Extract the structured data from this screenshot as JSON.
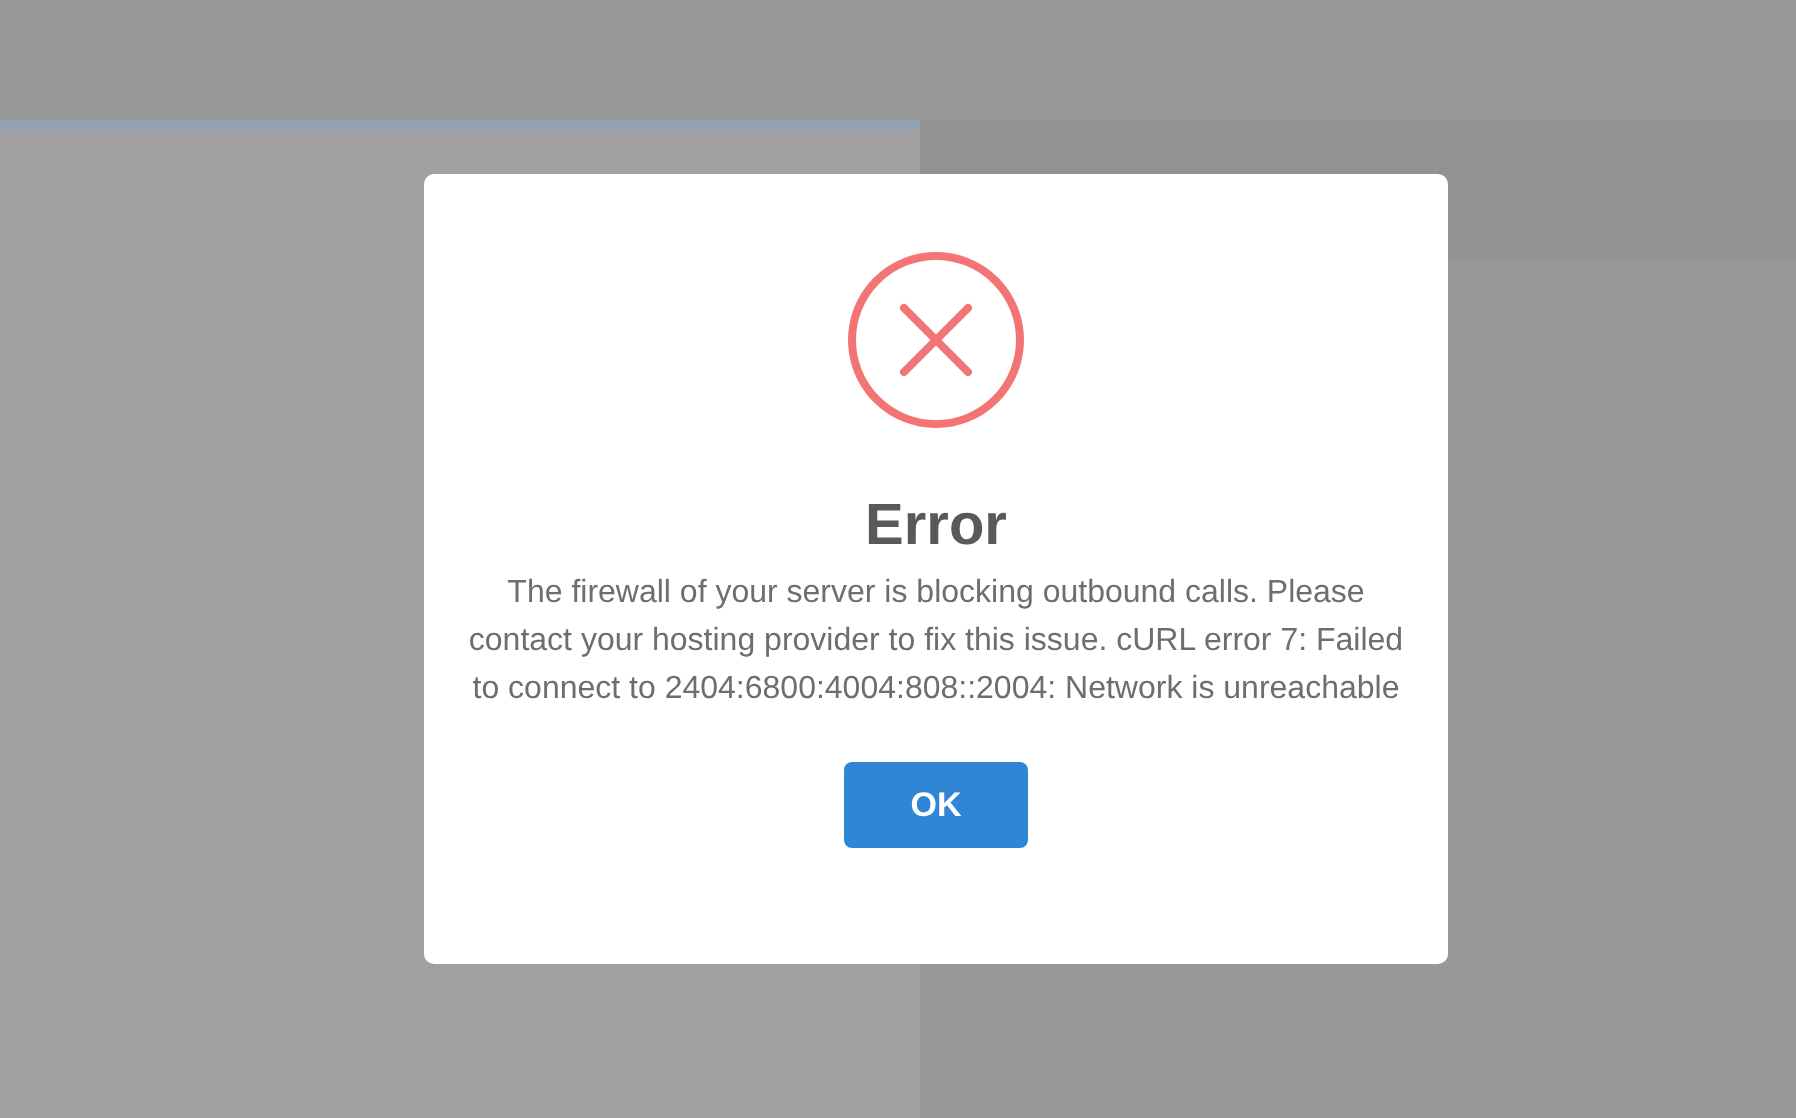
{
  "dialog": {
    "title": "Error",
    "message": "The firewall of your server is blocking outbound calls. Please contact your hosting provider to fix this issue. cURL error 7: Failed to connect to 2404:6800:4004:808::2004: Network is unreachable",
    "buttons": [
      "OK"
    ]
  }
}
